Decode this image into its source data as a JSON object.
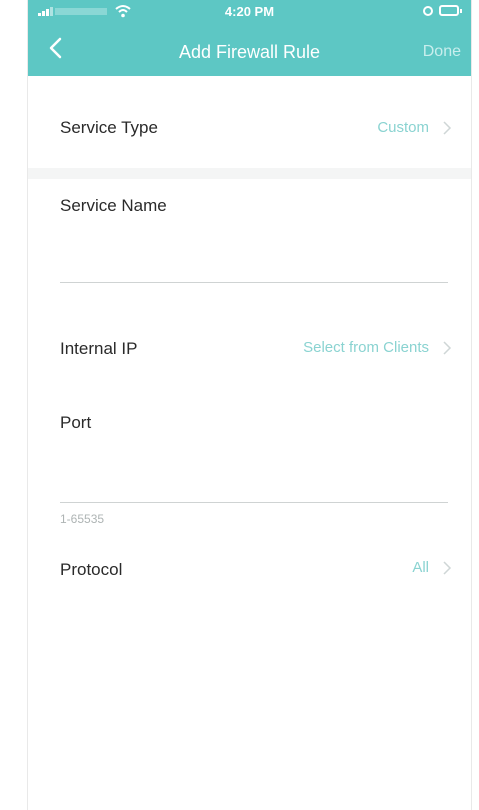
{
  "status_bar": {
    "time": "4:20 PM"
  },
  "nav": {
    "title": "Add Firewall Rule",
    "done_label": "Done"
  },
  "form": {
    "service_type": {
      "label": "Service Type",
      "value": "Custom"
    },
    "service_name": {
      "label": "Service Name",
      "value": ""
    },
    "internal_ip": {
      "label": "Internal IP",
      "action": "Select from Clients"
    },
    "port": {
      "label": "Port",
      "value": "",
      "hint": "1-65535"
    },
    "protocol": {
      "label": "Protocol",
      "value": "All"
    }
  },
  "colors": {
    "header": "#5dc7c4",
    "accent": "#8ad3d1",
    "separator": "#f4f5f5"
  },
  "icons": [
    "back-chevron-icon",
    "chevron-right-icon",
    "signal-icon",
    "wifi-icon",
    "alarm-icon",
    "battery-icon"
  ]
}
